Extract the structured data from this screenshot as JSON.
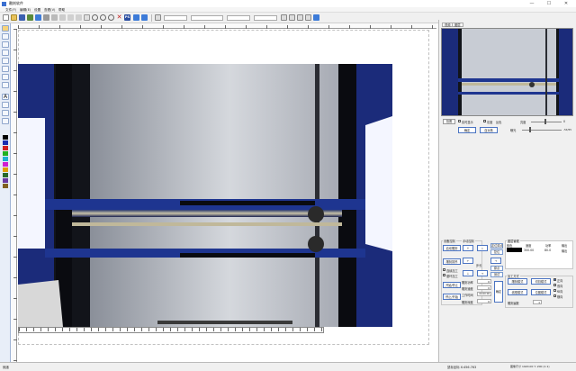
{
  "window": {
    "title": "雕刻软件",
    "minimize": "—",
    "maximize": "☐",
    "close": "✕"
  },
  "menu": [
    "文件(F)",
    "编辑(E)",
    "设置",
    "查看(V)",
    "帮助"
  ],
  "toolbar": {
    "zoom_value": "",
    "ps_label": "PS"
  },
  "right_tabs": [
    "视频",
    "图层"
  ],
  "preview_controls": {
    "capture": "拍照",
    "auto_display": "实时显示",
    "grayscale": "灰度",
    "invert": "反色",
    "brightness_label": "亮度",
    "contrast_label": "曝光",
    "brightness_value": "0",
    "contrast_value": "-54/55",
    "confirm": "确定",
    "auto_focus": "自对焦"
  },
  "device_control": {
    "group_title": "设备控制",
    "start_engrave": "启动雕刻",
    "stop_engrave": "雕刻暂停",
    "continue_engrave": "连续加工",
    "repeat_engrave": "循环加工",
    "preview": "开始/停止",
    "stop": "停止/开始"
  },
  "move_control": {
    "group_title": "手动控制",
    "up": "↑",
    "down": "↓",
    "left": "←",
    "right": "→",
    "origin": "原点",
    "step_label": "步长",
    "step_value": "1",
    "set_origin": "定位原点",
    "reset": "复位",
    "laser_test": "测试"
  },
  "params": {
    "power_label": "雕刻功率",
    "power_value": "0",
    "speed_label": "雕刻速度",
    "speed_value": "0",
    "time_label": "工作时间",
    "time_value": "00:00:00",
    "depth_label": "雕刻深度",
    "depth_value": "0",
    "apply": "确定"
  },
  "image_info": {
    "group_title": "图层管理",
    "col_color": "颜色",
    "col_speed": "速度",
    "col_power": "功率",
    "col_output": "输出",
    "row_speed": "300.00",
    "row_power": "80.0",
    "row_output": "输出"
  },
  "processing": {
    "group_title": "加工方式",
    "carve": "雕刻模式",
    "cut": "切割模式",
    "outline": "线框模式",
    "fill": "位图模式",
    "opt1": "正向",
    "opt2": "双向",
    "opt3": "纵向",
    "opt4": "横向",
    "count_label": "雕刻遍数",
    "count_value": "1"
  },
  "status": {
    "left": "就绪",
    "coords": "鼠标坐标 X:456.763",
    "size": "图像尺寸 1920.00 Y: 200 (1:1)"
  },
  "colors": {
    "accent": "#3c6cc7",
    "frame": "#1e48a8"
  }
}
